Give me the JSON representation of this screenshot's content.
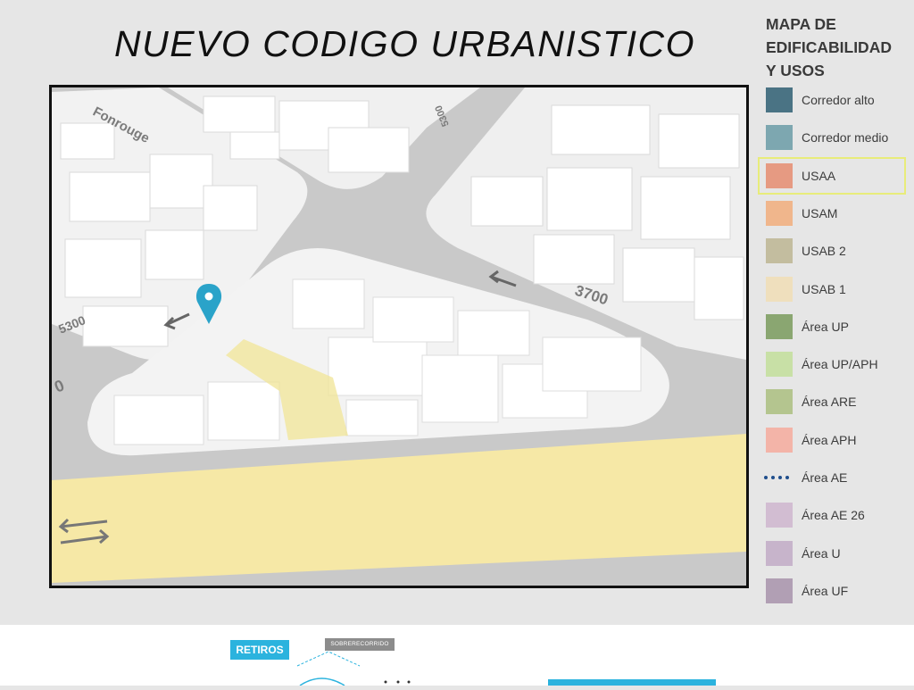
{
  "page": {
    "title": "NUEVO CODIGO URBANISTICO"
  },
  "map": {
    "street_labels": {
      "fonrouge": "Fonrouge",
      "number_3700": "3700",
      "number_5300": "5300",
      "number_5300_top": "5300",
      "number_partial": "0"
    },
    "marker_color": "#2aa3c9",
    "highlight_color": "#f1e59a",
    "avenue_color": "#f6e8a6",
    "block_color": "#f4f4f4",
    "road_color": "#c4c4c4"
  },
  "legend": {
    "title_line1": "MAPA DE",
    "title_line2": "EDIFICABILIDAD",
    "title_line3": "Y USOS",
    "highlight_outline": "#e8ec7a",
    "items": [
      {
        "label": "Corredor alto",
        "color": "#4a7384"
      },
      {
        "label": "Corredor medio",
        "color": "#7da7b0"
      },
      {
        "label": "USAA",
        "color": "#e69a82"
      },
      {
        "label": "USAM",
        "color": "#f0b68c"
      },
      {
        "label": "USAB 2",
        "color": "#c3bd9f"
      },
      {
        "label": "USAB 1",
        "color": "#efdfbd"
      },
      {
        "label": "Área UP",
        "color": "#8aa671"
      },
      {
        "label": "Área UP/APH",
        "color": "#c8e0a6"
      },
      {
        "label": "Área ARE",
        "color": "#b4c58f"
      },
      {
        "label": "Área APH",
        "color": "#f3b4a8"
      },
      {
        "label": "Área AE",
        "color": "#1f4e8c"
      },
      {
        "label": "Área AE 26",
        "color": "#d2bdd2"
      },
      {
        "label": "Área U",
        "color": "#c7b4cb"
      },
      {
        "label": "Área UF",
        "color": "#b19fb4"
      }
    ]
  },
  "bottom": {
    "retiros_label": "RETIROS",
    "sobre_label": "SOBRERECORRIDO",
    "tag_blue": "#2bb3de",
    "tag_gray": "#8c8c8c"
  }
}
